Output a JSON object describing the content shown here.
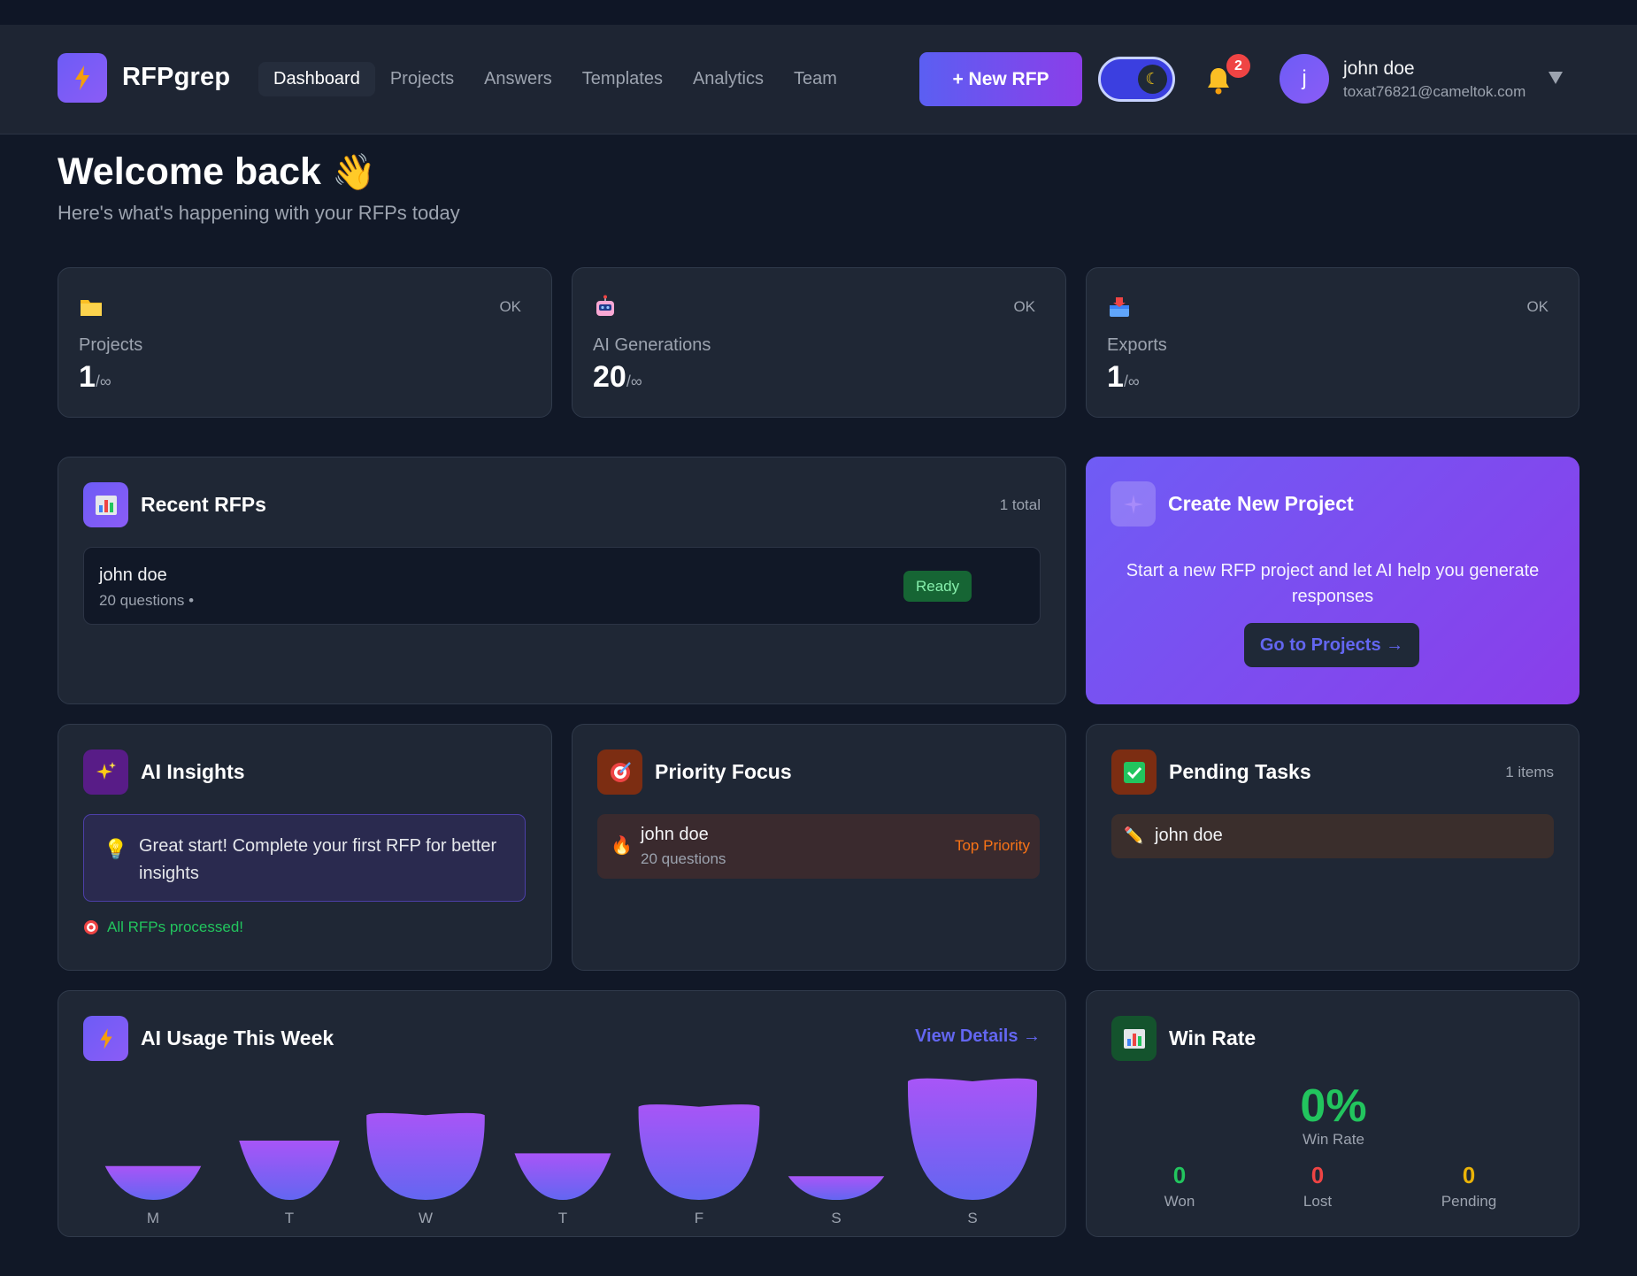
{
  "header": {
    "brand": "RFPgrep",
    "nav": [
      "Dashboard",
      "Projects",
      "Answers",
      "Templates",
      "Analytics",
      "Team"
    ],
    "active_nav": "Dashboard",
    "new_rfp_label": "+ New RFP",
    "notification_count": "2",
    "user": {
      "initial": "j",
      "name": "john doe",
      "email": "toxat76821@cameltok.com"
    }
  },
  "welcome": {
    "title": "Welcome back",
    "emoji": "👋",
    "subtitle": "Here's what's happening with your RFPs today"
  },
  "stats": [
    {
      "icon": "folder-icon",
      "status": "OK",
      "label": "Projects",
      "value": "1",
      "limit": "/∞"
    },
    {
      "icon": "robot-icon",
      "status": "OK",
      "label": "AI Generations",
      "value": "20",
      "limit": "/∞"
    },
    {
      "icon": "outbox-icon",
      "status": "OK",
      "label": "Exports",
      "value": "1",
      "limit": "/∞"
    }
  ],
  "recent_rfps": {
    "title": "Recent RFPs",
    "count": "1 total",
    "items": [
      {
        "name": "john doe",
        "meta": "20 questions •",
        "status": "Ready"
      }
    ]
  },
  "create_project": {
    "title": "Create New Project",
    "description": "Start a new RFP project and let AI help you generate responses",
    "button": "Go to Projects →"
  },
  "ai_insights": {
    "title": "AI Insights",
    "insight": "Great start! Complete your first RFP for better insights",
    "status": "All RFPs processed!"
  },
  "priority_focus": {
    "title": "Priority Focus",
    "item": {
      "name": "john doe",
      "meta": "20 questions",
      "tag": "Top Priority"
    }
  },
  "pending_tasks": {
    "title": "Pending Tasks",
    "count": "1 items",
    "items": [
      "john doe"
    ]
  },
  "ai_usage": {
    "title": "AI Usage This Week",
    "link": "View Details →"
  },
  "chart_data": {
    "type": "bar",
    "categories": [
      "M",
      "T",
      "W",
      "T",
      "F",
      "S",
      "S"
    ],
    "values": [
      4,
      7,
      10,
      5.5,
      11,
      2.8,
      14
    ],
    "ylim": [
      0,
      14
    ],
    "grid": false
  },
  "win_rate": {
    "title": "Win Rate",
    "percent": "0%",
    "label": "Win Rate",
    "won": "0",
    "won_label": "Won",
    "lost": "0",
    "lost_label": "Lost",
    "pending": "0",
    "pending_label": "Pending"
  },
  "colors": {
    "accent": "#6366f1",
    "brand_purple": "#8b5cf6",
    "success": "#22c55e",
    "danger": "#ef4444",
    "warning": "#eab308"
  }
}
